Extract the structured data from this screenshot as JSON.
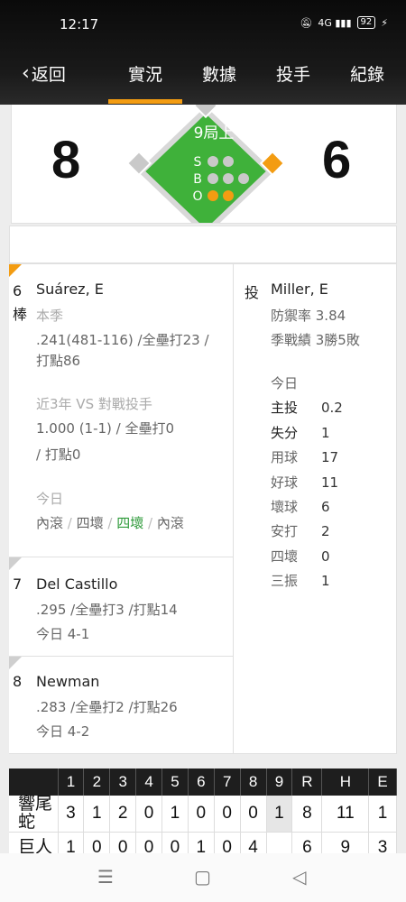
{
  "status": {
    "time": "12:17",
    "signal_text": "4G",
    "battery": "92"
  },
  "nav": {
    "back_label": "返回",
    "tabs": [
      {
        "label": "實況",
        "active": true
      },
      {
        "label": "數據",
        "active": false
      },
      {
        "label": "投手",
        "active": false
      },
      {
        "label": "紀錄",
        "active": false
      }
    ]
  },
  "score": {
    "away": "8",
    "home": "6",
    "inning": "9局上",
    "count": {
      "strikes": 2,
      "balls": 3,
      "outs": 2
    },
    "labels": {
      "s": "S",
      "b": "B",
      "o": "O"
    },
    "bases": {
      "first": true,
      "second": false,
      "third": false
    }
  },
  "batters": [
    {
      "order": "6",
      "order_suffix": "棒",
      "name": "Suárez, E",
      "season_label": "本季",
      "season_line1": ".241(481-116) /全壘打23 /",
      "season_line2": "打點86",
      "vs_label": "近3年 VS 對戰投手",
      "vs_line1": "1.000 (1-1) / 全壘打0",
      "vs_line2": "/ 打點0",
      "today_label": "今日",
      "today_results": [
        "內滾",
        "四壞",
        "四壞",
        "內滾"
      ]
    },
    {
      "order": "7",
      "name": "Del Castillo",
      "line1": ".295 /全壘打3 /打點14",
      "line2": "今日 4-1"
    },
    {
      "order": "8",
      "name": "Newman",
      "line1": ".283 /全壘打2 /打點26",
      "line2": "今日 4-2"
    }
  ],
  "pitcher": {
    "label": "投",
    "name": "Miller, E",
    "era": "防禦率 3.84",
    "record": "季戰績 3勝5敗",
    "today_label": "今日",
    "stats": [
      {
        "k": "主投",
        "v": "0.2"
      },
      {
        "k": "失分",
        "v": "1"
      },
      {
        "k": "用球",
        "v": "17"
      },
      {
        "k": "好球",
        "v": "11"
      },
      {
        "k": "壞球",
        "v": "6"
      },
      {
        "k": "安打",
        "v": "2"
      },
      {
        "k": "四壞",
        "v": "0"
      },
      {
        "k": "三振",
        "v": "1"
      }
    ]
  },
  "linescore": {
    "headers": [
      "",
      "1",
      "2",
      "3",
      "4",
      "5",
      "6",
      "7",
      "8",
      "9",
      "R",
      "H",
      "E"
    ],
    "rows": [
      {
        "team": "響尾蛇",
        "cells": [
          "3",
          "1",
          "2",
          "0",
          "1",
          "0",
          "0",
          "0",
          "1",
          "8",
          "11",
          "1"
        ]
      },
      {
        "team": "巨人",
        "cells": [
          "1",
          "0",
          "0",
          "0",
          "0",
          "1",
          "0",
          "4",
          "",
          "6",
          "9",
          "3"
        ]
      }
    ]
  },
  "colors": {
    "accent": "#f39c12",
    "field": "#3fb13a",
    "header": "#111111",
    "ball_gray": "#c9c9c9"
  }
}
